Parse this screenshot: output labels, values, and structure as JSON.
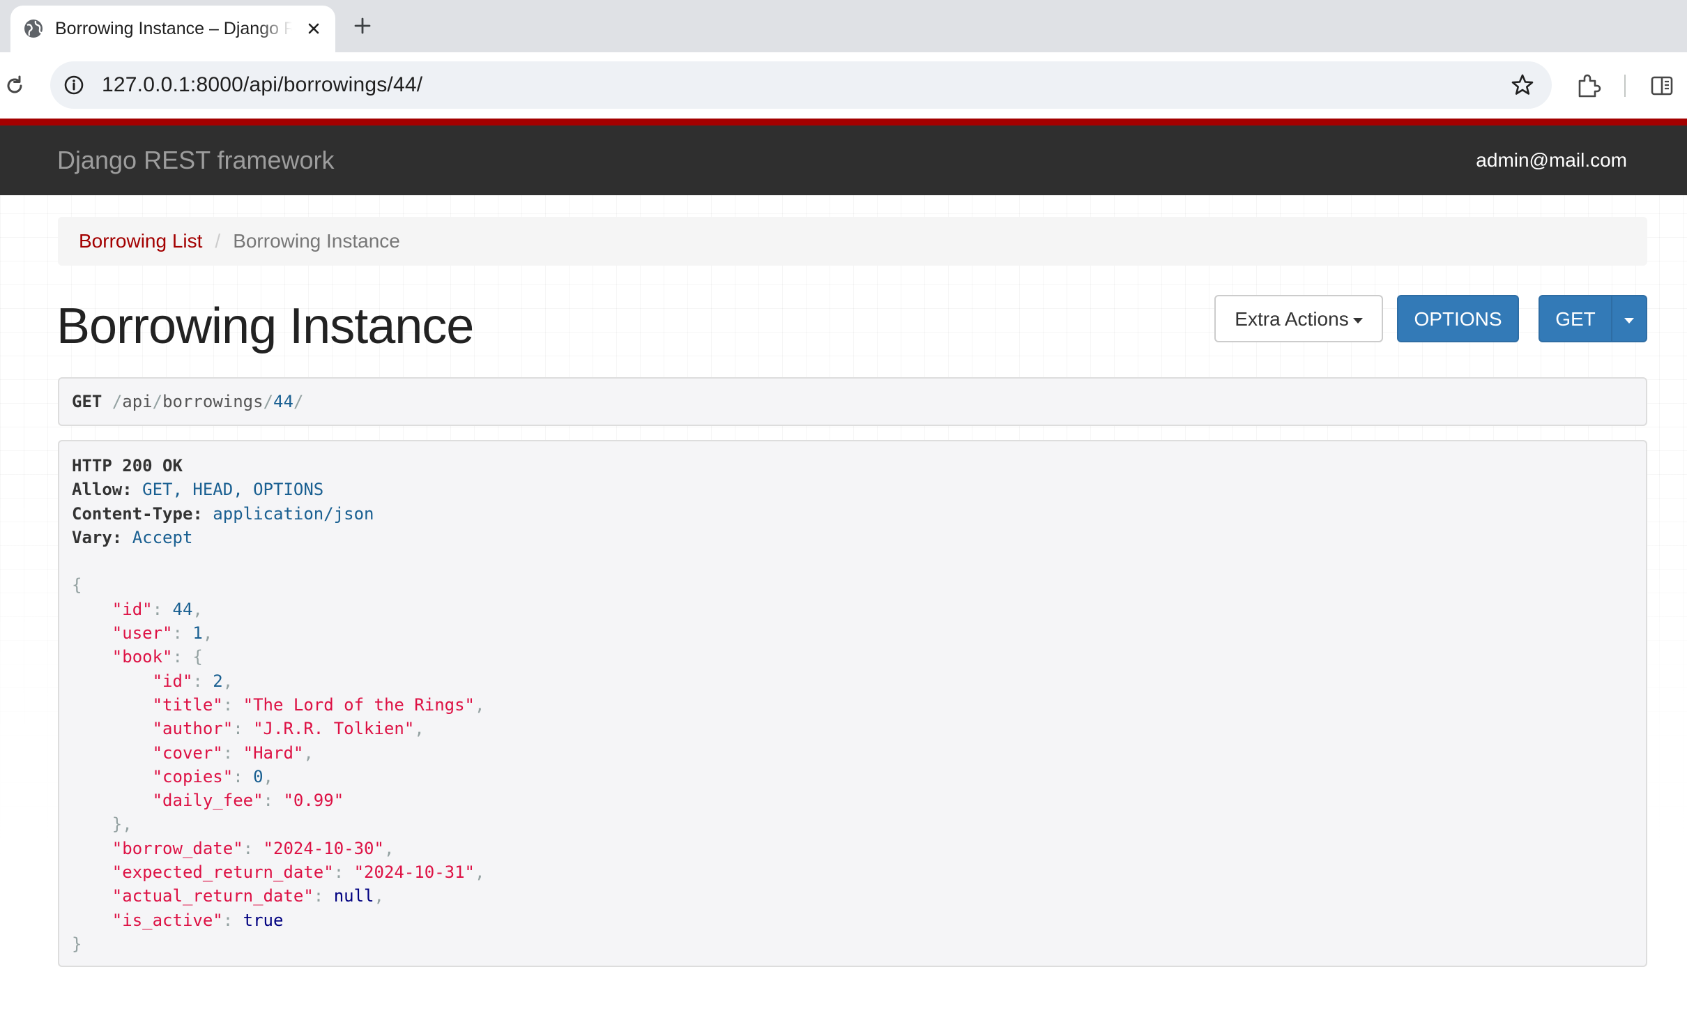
{
  "browser": {
    "tab_title": "Borrowing Instance – Django REST framework",
    "url": "127.0.0.1:8000/api/borrowings/44/"
  },
  "navbar": {
    "brand": "Django REST framework",
    "user": "admin@mail.com"
  },
  "breadcrumb": {
    "link": "Borrowing List",
    "separator": "/",
    "active": "Borrowing Instance"
  },
  "page": {
    "title": "Borrowing Instance"
  },
  "buttons": {
    "extra_actions": "Extra Actions",
    "options": "OPTIONS",
    "get": "GET"
  },
  "request": {
    "method": "GET",
    "path_parts": [
      "/",
      "api",
      "/",
      "borrowings",
      "/",
      "44",
      "/"
    ]
  },
  "response": {
    "status": "HTTP 200 OK",
    "headers": [
      {
        "name": "Allow:",
        "value": "GET, HEAD, OPTIONS"
      },
      {
        "name": "Content-Type:",
        "value": "application/json"
      },
      {
        "name": "Vary:",
        "value": "Accept"
      }
    ],
    "body": {
      "id_key": "\"id\"",
      "id_val": "44",
      "user_key": "\"user\"",
      "user_val": "1",
      "book_key": "\"book\"",
      "book_id_key": "\"id\"",
      "book_id_val": "2",
      "title_key": "\"title\"",
      "title_val": "\"The Lord of the Rings\"",
      "author_key": "\"author\"",
      "author_val": "\"J.R.R. Tolkien\"",
      "cover_key": "\"cover\"",
      "cover_val": "\"Hard\"",
      "copies_key": "\"copies\"",
      "copies_val": "0",
      "fee_key": "\"daily_fee\"",
      "fee_val": "\"0.99\"",
      "borrow_key": "\"borrow_date\"",
      "borrow_val": "\"2024-10-30\"",
      "expected_key": "\"expected_return_date\"",
      "expected_val": "\"2024-10-31\"",
      "actual_key": "\"actual_return_date\"",
      "actual_val": "null",
      "active_key": "\"is_active\"",
      "active_val": "true"
    }
  },
  "colors": {
    "accent_red": "#a30000",
    "navbar": "#2f2f2f",
    "button_blue": "#337ab7",
    "json_string": "#dd1144",
    "json_literal": "#195f91"
  },
  "icons": [
    "globe-icon",
    "close-icon",
    "plus-icon",
    "reload-icon",
    "site-info-icon",
    "star-icon",
    "extensions-icon",
    "side-panel-icon",
    "caret-down-icon"
  ]
}
